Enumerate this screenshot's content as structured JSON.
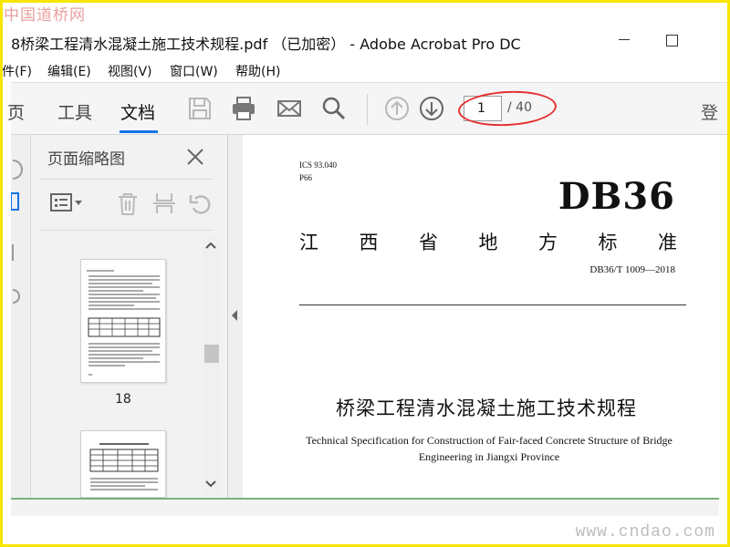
{
  "watermark": {
    "top": "中国道桥网",
    "bottom": "www.cndao.com"
  },
  "window": {
    "title": "8桥梁工程清水混凝土施工技术规程.pdf （已加密） - Adobe Acrobat Pro DC"
  },
  "menu": {
    "items": [
      "件(F)",
      "编辑(E)",
      "视图(V)",
      "窗口(W)",
      "帮助(H)"
    ]
  },
  "toolbar": {
    "tabs": [
      "页",
      "工具",
      "文档"
    ],
    "page_current": "1",
    "page_total": "/ 40",
    "login": "登"
  },
  "thumbnails_panel": {
    "title": "页面缩略图",
    "pages": [
      {
        "label": "18"
      }
    ]
  },
  "document": {
    "ics": "ICS 93.040",
    "class_code": "P66",
    "standard_code": "DB36",
    "standard_type_chars": [
      "江",
      "西",
      "省",
      "地",
      "方",
      "标",
      "准"
    ],
    "standard_number": "DB36/T 1009—2018",
    "title_cn": "桥梁工程清水混凝土施工技术规程",
    "title_en": "Technical Specification for Construction of Fair-faced Concrete Structure of Bridge Engineering in Jiangxi Province"
  },
  "colors": {
    "frame": "#f7e600",
    "annotation": "#e53030",
    "accent": "#1473e6"
  },
  "icons": [
    "save-icon",
    "print-icon",
    "email-icon",
    "search-icon",
    "prev-page-icon",
    "next-page-icon",
    "close-icon",
    "options-menu-icon",
    "delete-icon",
    "extract-icon",
    "undo-icon"
  ]
}
